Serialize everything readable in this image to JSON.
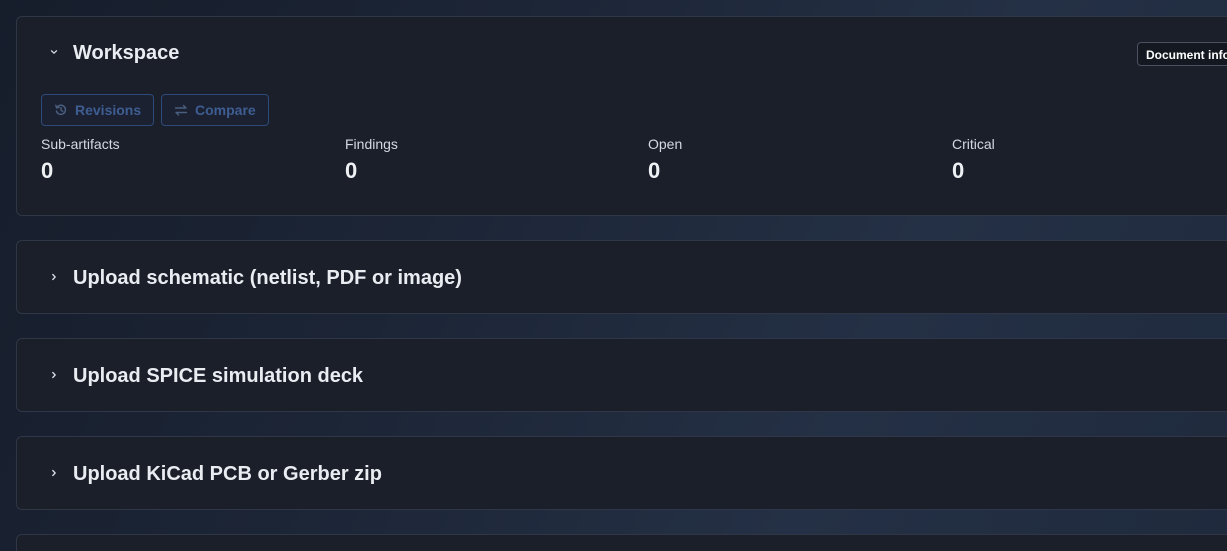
{
  "workspace": {
    "title": "Workspace",
    "document_info_label": "Document info",
    "buttons": {
      "revisions": "Revisions",
      "compare": "Compare"
    },
    "stats": [
      {
        "label": "Sub-artifacts",
        "value": "0"
      },
      {
        "label": "Findings",
        "value": "0"
      },
      {
        "label": "Open",
        "value": "0"
      },
      {
        "label": "Critical",
        "value": "0"
      }
    ]
  },
  "sections": [
    {
      "title": "Upload schematic (netlist, PDF or image)"
    },
    {
      "title": "Upload SPICE simulation deck"
    },
    {
      "title": "Upload KiCad PCB or Gerber zip"
    }
  ],
  "colors": {
    "panel_bg": "#1b1f2a",
    "panel_border": "#2f3645",
    "button_text": "#3e5d92",
    "button_border": "#2e4a7a"
  },
  "icons": {
    "expanded": "chevron-down-icon",
    "collapsed": "chevron-right-icon",
    "revisions": "history-icon",
    "compare": "swap-arrows-icon"
  }
}
